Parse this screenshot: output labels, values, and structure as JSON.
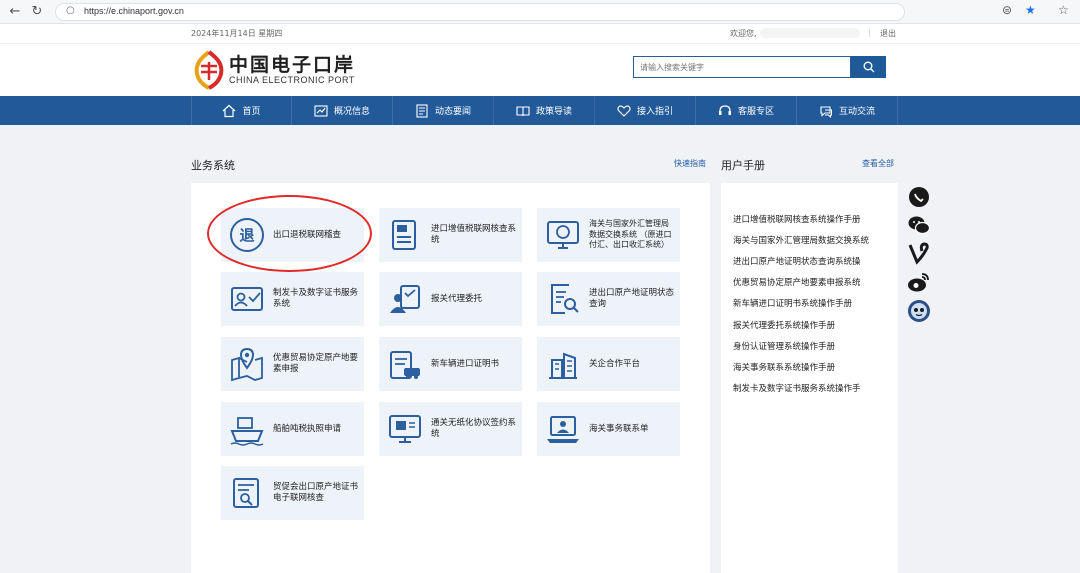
{
  "browser": {
    "url": "https://e.chinaport.gov.cn"
  },
  "topbar": {
    "date": "2024年11月14日 星期四",
    "welcome": "欢迎您,",
    "separator": "|",
    "logout": "退出"
  },
  "header": {
    "brand_cn": "中国电子口岸",
    "brand_en": "CHINA ELECTRONIC PORT",
    "search_placeholder": "请输入搜索关键字"
  },
  "nav": [
    {
      "label": "首页",
      "icon": "home-icon"
    },
    {
      "label": "概况信息",
      "icon": "chart-icon"
    },
    {
      "label": "动态要闻",
      "icon": "news-icon"
    },
    {
      "label": "政策导读",
      "icon": "book-icon"
    },
    {
      "label": "接入指引",
      "icon": "heart-icon"
    },
    {
      "label": "客服专区",
      "icon": "headset-icon"
    },
    {
      "label": "互动交流",
      "icon": "chat-icon"
    }
  ],
  "business": {
    "title": "业务系统",
    "link": "快速指南",
    "tiles": [
      {
        "label": "出口退税联网稽查",
        "icon": "tax-refund-icon"
      },
      {
        "label": "进口增值税联网核查系统",
        "icon": "vat-document-icon"
      },
      {
        "label": "海关与国家外汇管理局数据交换系统 （原进口付汇、出口收汇系统）",
        "icon": "forex-monitor-icon"
      },
      {
        "label": "制发卡及数字证书服务系统",
        "icon": "id-card-icon"
      },
      {
        "label": "报关代理委托",
        "icon": "agent-clipboard-icon"
      },
      {
        "label": "进出口原产地证明状态查询",
        "icon": "origin-search-icon"
      },
      {
        "label": "优惠贸易协定原产地要素申报",
        "icon": "map-pin-icon"
      },
      {
        "label": "新车辆进口证明书",
        "icon": "vehicle-certificate-icon"
      },
      {
        "label": "关企合作平台",
        "icon": "customs-building-icon"
      },
      {
        "label": "船舶吨税执照申请",
        "icon": "ship-icon"
      },
      {
        "label": "通关无纸化协议签约系统",
        "icon": "paperless-monitor-icon"
      },
      {
        "label": "海关事务联系单",
        "icon": "laptop-user-icon"
      },
      {
        "label": "贸促会出口原产地证书电子联网核查",
        "icon": "certificate-search-icon"
      }
    ]
  },
  "manuals": {
    "title": "用户手册",
    "link": "查看全部",
    "items": [
      "进口增值税联网核查系统操作手册",
      "海关与国家外汇管理局数据交换系统",
      "进出口原产地证明状态查询系统操",
      "优惠贸易协定原产地要素申报系统",
      "新车辆进口证明书系统操作手册",
      "报关代理委托系统操作手册",
      "身份认证管理系统操作手册",
      "海关事务联系系统操作手册",
      "制发卡及数字证书服务系统操作手"
    ]
  },
  "social": [
    "whatsapp-icon",
    "wechat-icon",
    "vine-icon",
    "weibo-icon",
    "avatar-icon"
  ],
  "colors": {
    "nav_bg": "#225a99",
    "tile_bg": "#eef3fa",
    "icon_blue": "#2c5f9e",
    "highlight": "#e02a2a"
  }
}
